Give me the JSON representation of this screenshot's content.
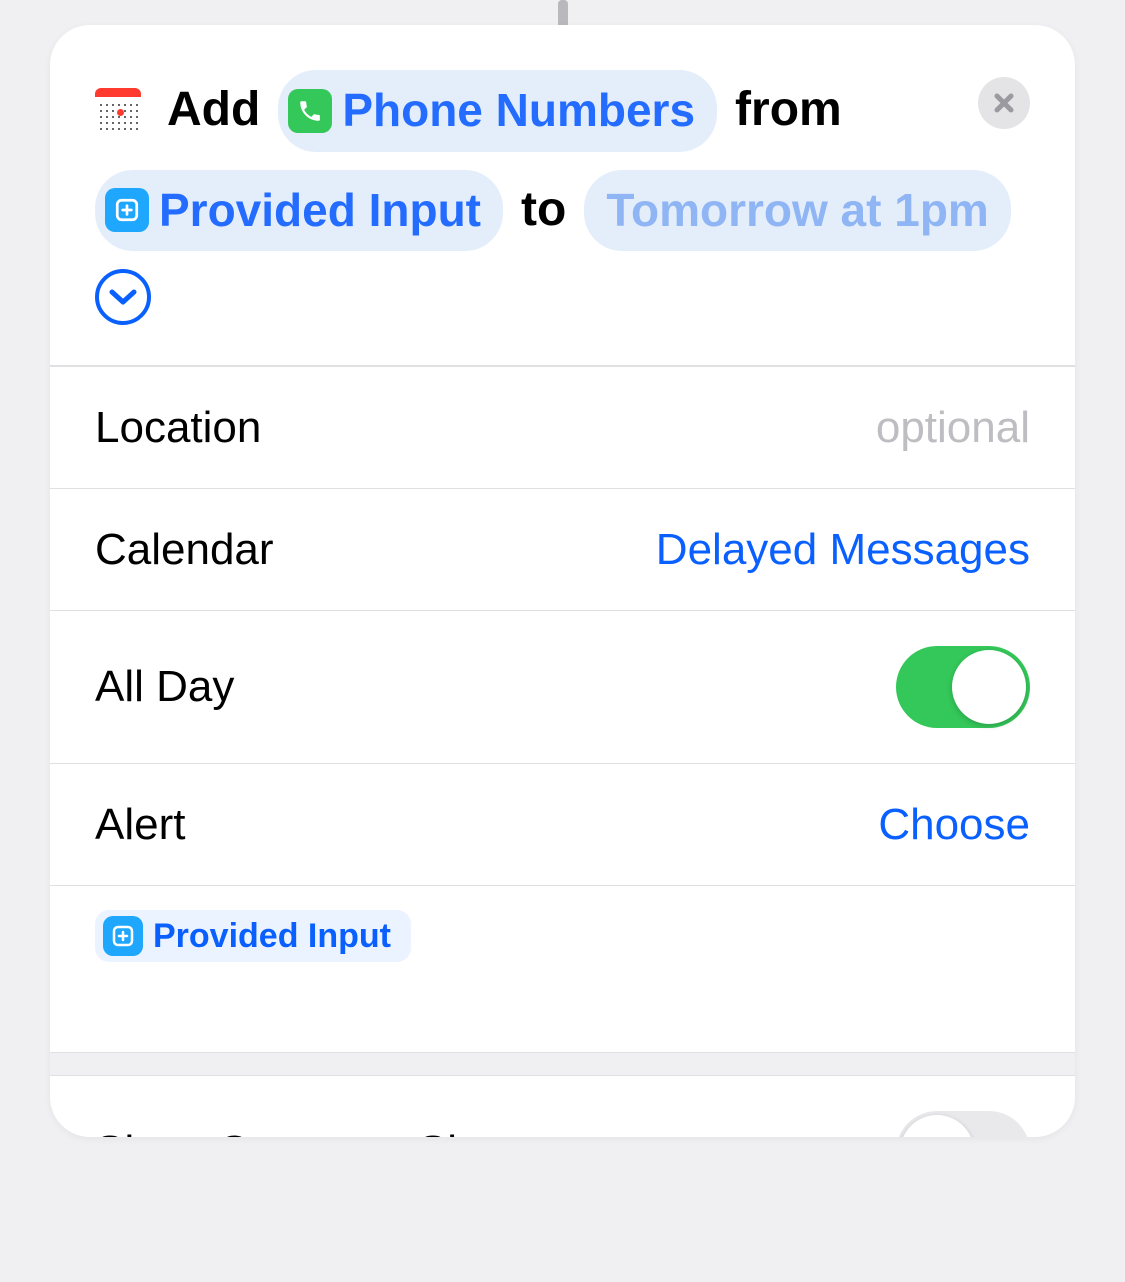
{
  "header": {
    "action": "Add",
    "token1": "Phone Numbers",
    "word_from": "from",
    "token2": "Provided Input",
    "word_to": "to",
    "token3": "Tomorrow at 1pm"
  },
  "rows": {
    "location_label": "Location",
    "location_placeholder": "optional",
    "calendar_label": "Calendar",
    "calendar_value": "Delayed Messages",
    "allday_label": "All Day",
    "alert_label": "Alert",
    "alert_value": "Choose",
    "notes_token": "Provided Input",
    "compose_label": "Show Compose Sheet"
  }
}
